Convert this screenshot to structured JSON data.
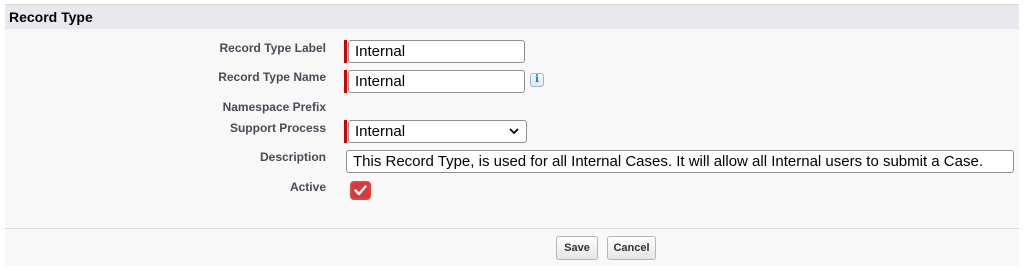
{
  "section": {
    "title": "Record Type"
  },
  "fields": {
    "record_type_label": {
      "label": "Record Type Label",
      "value": "Internal"
    },
    "record_type_name": {
      "label": "Record Type Name",
      "value": "Internal",
      "info_icon": "i"
    },
    "namespace_prefix": {
      "label": "Namespace Prefix",
      "value": ""
    },
    "support_process": {
      "label": "Support Process",
      "value": "Internal"
    },
    "description": {
      "label": "Description",
      "value": "This Record Type, is used for all Internal Cases. It will allow all Internal users to submit a Case."
    },
    "active": {
      "label": "Active",
      "checked": true
    }
  },
  "buttons": {
    "save": "Save",
    "cancel": "Cancel"
  },
  "colors": {
    "required": "#cc0000",
    "checkbox": "#d63a3a",
    "header_bg": "#e8e9ee"
  }
}
